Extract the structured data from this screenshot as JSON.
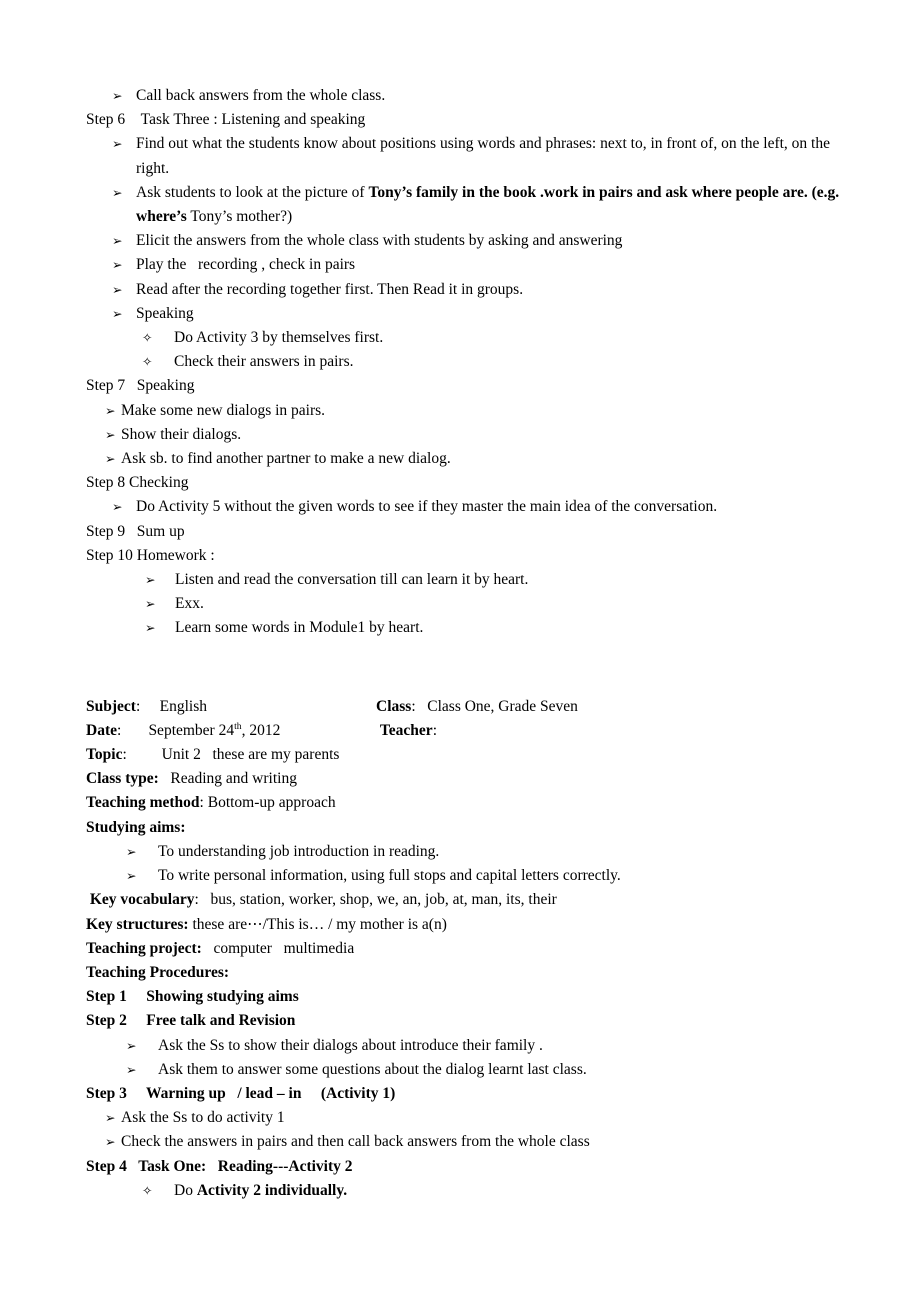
{
  "document": {
    "bullet_arrow": "➢",
    "bullet_diamond": "✧",
    "section1": {
      "items": [
        "Call back answers from the whole class.",
        "Step 6 Task Three : Listening and speaking",
        "Find out what the students know about positions using words and phrases: next to, in front of, on the left, on the right.",
        "Elicit the answers from the whole class with students by asking and answering",
        "Play the   recording , check in pairs",
        "Read after the recording together first. Then Read it in groups.",
        "Speaking",
        "Do Activity 3 by themselves first.",
        "Check their answers in pairs.",
        "Step 7  Speaking",
        "Make some new dialogs in pairs.",
        "Show their dialogs.",
        "Ask sb. to find another partner to make a new dialog.",
        "Step 8 Checking",
        "Do Activity 5 without the given words to see if they master the main idea of the conversation.",
        "Step 9  Sum up",
        "Step 10 Homework :",
        "Listen and read the conversation till can learn it by heart.",
        "Exx.",
        "Learn some words in Module1 by heart."
      ],
      "tony_line": {
        "lead": "Ask students to look at the picture of ",
        "bold1": "Tony’s family in the book .work in pairs and ask where people are. (e.g. where’s",
        "tail": " Tony’s mother?)"
      }
    },
    "section2": {
      "subject_label": "Subject",
      "subject_colon": ":",
      "subject_value": "English",
      "class_label": "Class",
      "class_colon": ":",
      "class_value": "Class One, Grade Seven",
      "date_label": "Date",
      "date_colon": ":",
      "date_value_pre": "September 24",
      "date_value_sup": "th",
      "date_value_post": ", 2012",
      "teacher_label": "Teacher",
      "teacher_colon": ":",
      "teacher_value": "",
      "topic_label": "Topic",
      "topic_colon": ":",
      "topic_value": "Unit 2   these are my parents",
      "classtype_label": "Class type:",
      "classtype_value": "Reading and writing",
      "method_label": "Teaching method",
      "method_colon": ":",
      "method_value": "Bottom-up approach",
      "aims_heading": "Studying aims:",
      "aims": [
        "To understanding job introduction in reading.",
        "To write personal information, using full stops and capital letters correctly."
      ],
      "vocab_label": "Key vocabulary",
      "vocab_colon": ":",
      "vocab_value": "bus, station, worker, shop, we, an, job, at, man, its, their",
      "structures_label": "Key structures:",
      "structures_value": "these are⋯/This is… / my mother is a(n)",
      "project_label": "Teaching project:",
      "project_value": "computer   multimedia",
      "procedures_heading": "Teaching Procedures:",
      "step1": "Step 1  Showing studying aims",
      "step2": "Step 2  Free talk and Revision",
      "step2_bullets": [
        "Ask the Ss to show their dialogs about introduce their family .",
        "Ask them to answer some questions about the dialog learnt last class."
      ],
      "step3": "Step 3  Warning up   / lead – in     (Activity 1)",
      "step3_bullets": [
        "Ask the Ss to do activity 1",
        "Check the answers in pairs and then call back answers from the whole class"
      ],
      "step4": "Step 4  Task One:   Reading---Activity 2",
      "step4_bullet_lead": "Do ",
      "step4_bullet_bold": "Activity 2 individually."
    }
  }
}
